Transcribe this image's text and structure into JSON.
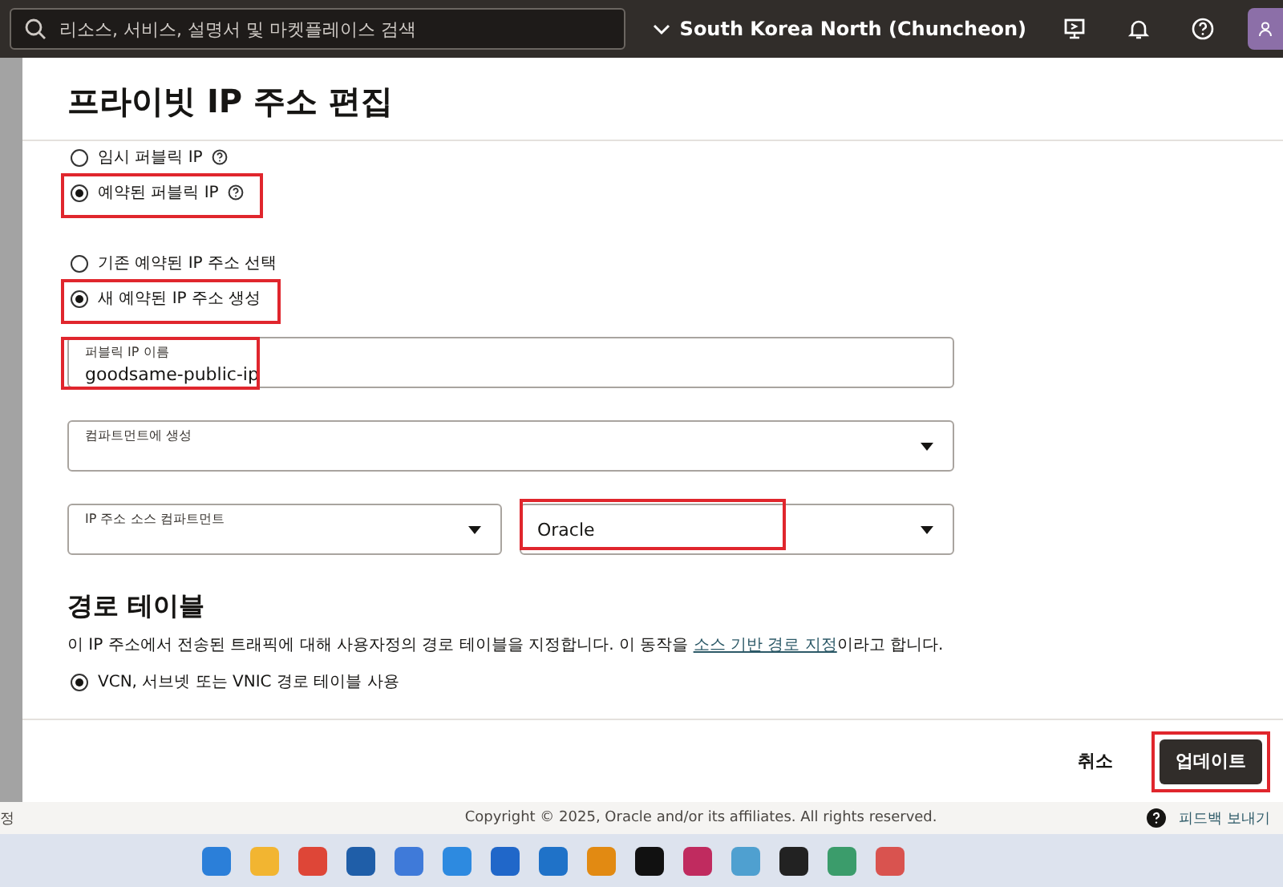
{
  "top_bar": {
    "search": {
      "placeholder": "리소스, 서비스, 설명서 및 마켓플레이스 검색"
    },
    "region": "South Korea North (Chuncheon)"
  },
  "panel": {
    "title": "프라이빗 IP 주소 편집",
    "ip_options": [
      {
        "label": "임시 퍼블릭 IP",
        "selected": false,
        "highlighted": false
      },
      {
        "label": "예약된 퍼블릭 IP",
        "selected": true,
        "highlighted": true
      }
    ],
    "reserved_options": [
      {
        "label": "기존 예약된 IP 주소 선택",
        "selected": false,
        "highlighted": false
      },
      {
        "label": "새 예약된 IP 주소 생성",
        "selected": true,
        "highlighted": true
      }
    ],
    "name_field": {
      "label": "퍼블릭 IP 이름",
      "value": "goodsame-public-ip",
      "highlighted": true
    },
    "compartment_select": {
      "label": "컴파트먼트에 생성"
    },
    "source_selects": [
      {
        "label": "IP 주소 소스 컴파트먼트",
        "highlighted": false
      },
      {
        "value": "Oracle",
        "highlighted": true
      }
    ],
    "route_section": {
      "heading": "경로 테이블",
      "description_before": "이 IP 주소에서 전송된 트래픽에 대해 사용자정의 경로 테이블을 지정합니다. 이 동작을 ",
      "link": "소스 기반 경로 지정",
      "description_after": "이라고 합니다.",
      "options": [
        {
          "label": "VCN, 서브넷 또는 VNIC 경로 테이블 사용",
          "selected": true
        }
      ]
    },
    "cancel_button": "취소",
    "update_button": {
      "label": "업데이트",
      "highlighted": true
    }
  },
  "footer": {
    "left_fragment": "정",
    "copyright": "Copyright © 2025, Oracle and/or its affiliates. All rights reserved.",
    "feedback": "피드백 보내기"
  }
}
